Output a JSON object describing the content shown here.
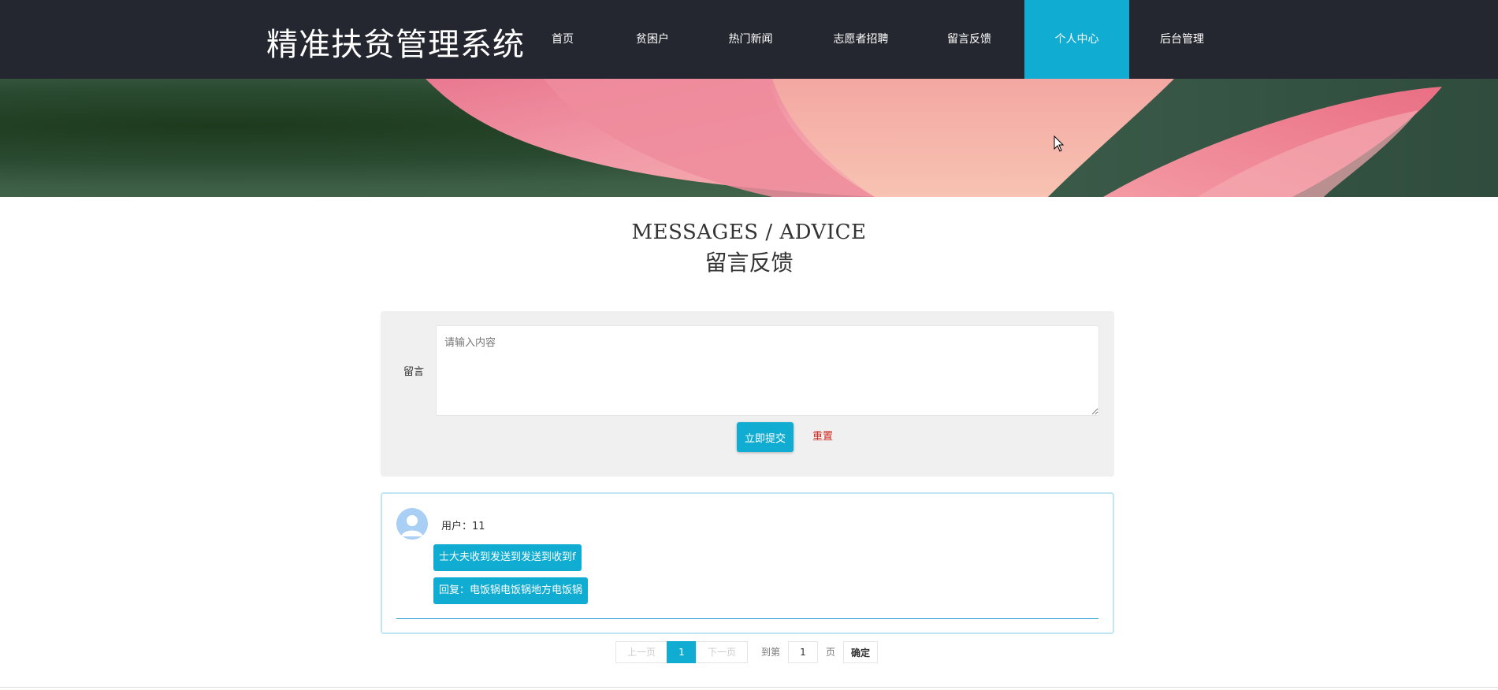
{
  "header": {
    "site_title": "精准扶贫管理系统",
    "nav": [
      {
        "label": "首页",
        "active": false
      },
      {
        "label": "贫困户",
        "active": false
      },
      {
        "label": "热门新闻",
        "active": false
      },
      {
        "label": "志愿者招聘",
        "active": false
      },
      {
        "label": "留言反馈",
        "active": false
      },
      {
        "label": "个人中心",
        "active": true
      },
      {
        "label": "后台管理",
        "active": false
      }
    ]
  },
  "banner": {
    "icon": "lotus-flower-image"
  },
  "section": {
    "title_en": "MESSAGES / ADVICE",
    "title_cn": "留言反馈"
  },
  "form": {
    "label": "留言",
    "placeholder": "请输入内容",
    "value": "",
    "submit_label": "立即提交",
    "reset_label": "重置"
  },
  "messages": [
    {
      "user_label": "用户：11",
      "content": "士大夫收到发送到发送到收到f",
      "reply": "回复：电饭锅电饭锅地方电饭锅"
    }
  ],
  "pagination": {
    "prev_label": "上一页",
    "current_page": "1",
    "next_label": "下一页",
    "goto_label": "到第",
    "page_input_value": "1",
    "page_suffix": "页",
    "confirm_label": "确定"
  },
  "colors": {
    "header_bg": "#24272f",
    "accent": "#10acd2",
    "reset_red": "#d0281f",
    "form_bg": "#f0f0f0"
  }
}
